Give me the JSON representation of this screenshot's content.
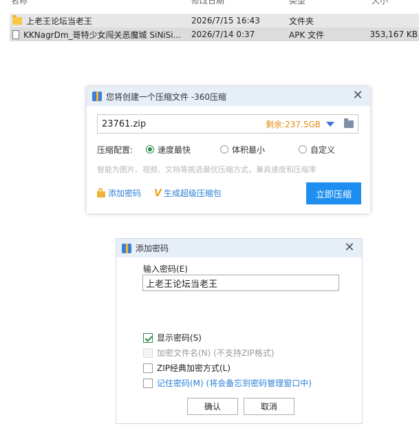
{
  "file_list": {
    "columns": {
      "name": "名称",
      "date": "修改日期",
      "type": "类型",
      "size": "大小"
    },
    "rows": [
      {
        "name": "上老王论坛当老王",
        "date": "2026/7/15 16:43",
        "type": "文件夹",
        "size": "",
        "icon": "folder-icon"
      },
      {
        "name": "KKNagrDm_哥特少女闯关恶魔城 SiNiSi...",
        "date": "2026/7/14 0:37",
        "type": "APK 文件",
        "size": "353,167 KB",
        "icon": "file-icon"
      }
    ]
  },
  "compress_dialog": {
    "title": "您将创建一个压缩文件 -360压缩",
    "filename": "23761.zip",
    "free_space": "剩余:237.5GB",
    "config_label": "压缩配置:",
    "options": [
      {
        "label": "速度最快",
        "selected": true
      },
      {
        "label": "体积最小",
        "selected": false
      },
      {
        "label": "自定义",
        "selected": false
      }
    ],
    "hint": "智能为图片、视频、文档等挑选最优压缩方式，兼具速度和压缩率",
    "add_password": "添加密码",
    "super_package": "生成超级压缩包",
    "compress_button": "立即压缩",
    "colors": {
      "accent": "#1f8ef1",
      "free_space": "#e48a12",
      "title_bg": "#e6eef8"
    }
  },
  "password_dialog": {
    "title": "添加密码",
    "input_label": "输入密码(E)",
    "password_value": "上老王论坛当老王",
    "checkboxes": [
      {
        "label": "显示密码(S)",
        "checked": true,
        "disabled": false
      },
      {
        "label": "加密文件名(N) (不支持ZIP格式)",
        "checked": false,
        "disabled": true
      },
      {
        "label": "ZIP经典加密方式(L)",
        "checked": false,
        "disabled": false
      },
      {
        "label": "记住密码(M) (将会备忘到密码管理窗口中)",
        "checked": false,
        "disabled": false
      }
    ],
    "ok_button": "确认",
    "cancel_button": "取消"
  }
}
